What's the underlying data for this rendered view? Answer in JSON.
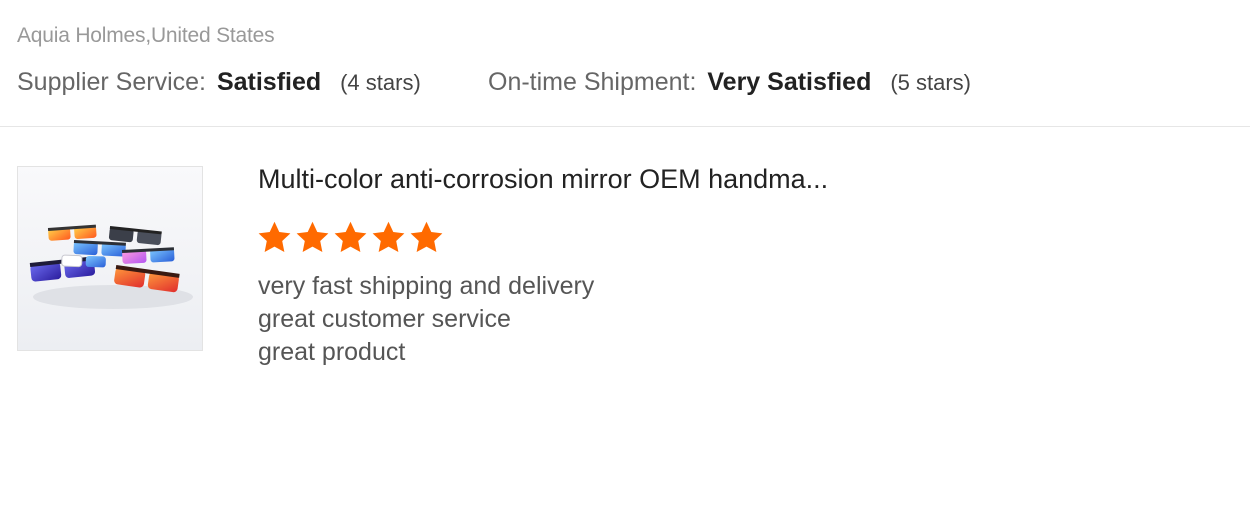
{
  "reviewer": {
    "name_location": "Aquia Holmes,United States"
  },
  "ratings": {
    "supplier_service": {
      "label": "Supplier Service:",
      "value": "Satisfied",
      "stars_text": "(4 stars)",
      "stars": 4
    },
    "ontime_shipment": {
      "label": "On-time Shipment:",
      "value": "Very Satisfied",
      "stars_text": "(5 stars)",
      "stars": 5
    }
  },
  "product": {
    "title": "Multi-color anti-corrosion mirror OEM handma...",
    "image_icon": "sunglasses-product-photo",
    "rating": 5,
    "rating_max": 5,
    "star_color": "#ff6a00"
  },
  "feedback": {
    "lines": [
      "very fast shipping and delivery",
      "great customer service",
      "great product"
    ]
  }
}
